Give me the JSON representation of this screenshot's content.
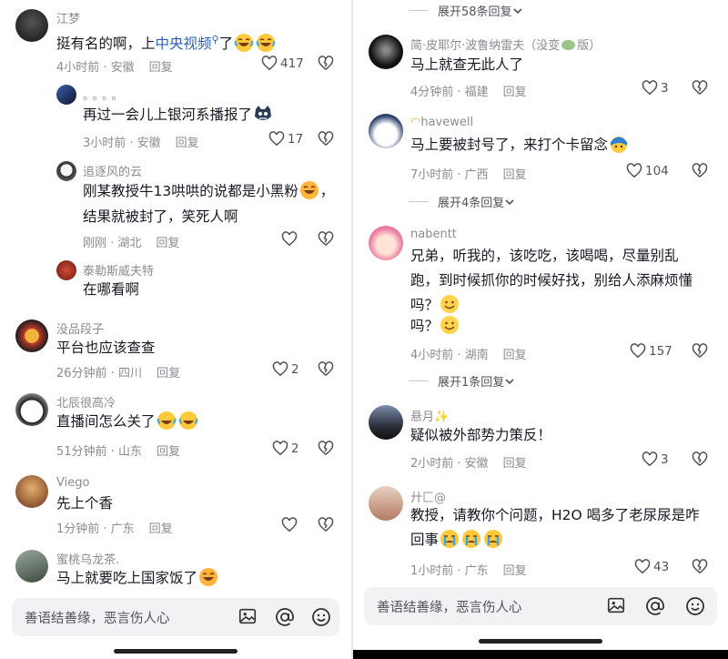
{
  "left": {
    "comments": [
      {
        "name": "江梦",
        "text_before": "挺有名的啊，上",
        "link": "中央视频",
        "text_after": "了",
        "time": "4小时前 · 安徽",
        "reply": "回复",
        "likes": "417"
      },
      {
        "name": "。。。。",
        "text": "再过一会儿上银河系播报了",
        "time": "3小时前 · 安徽",
        "reply": "回复",
        "likes": "17"
      },
      {
        "name": "追逐风的云",
        "text": "刚某教授牛13哄哄的说都是小黑粉",
        "text2": "结果就被封了，笑死人啊",
        "time": "刚刚 · 湖北",
        "reply": "回复",
        "likes": ""
      },
      {
        "name": "泰勒斯威夫特",
        "text": "在哪看啊"
      },
      {
        "name": "没品段子",
        "text": "平台也应该查查",
        "time": "26分钟前 · 四川",
        "reply": "回复",
        "likes": "2"
      },
      {
        "name": "北辰很高冷",
        "text": "直播间怎么关了",
        "time": "51分钟前 · 山东",
        "reply": "回复",
        "likes": "2"
      },
      {
        "name": "Viego",
        "text": "先上个香",
        "time": "1分钟前 · 广东",
        "reply": "回复",
        "likes": ""
      },
      {
        "name": "蜜桃乌龙茶.",
        "text": "马上就要吃上国家饭了"
      }
    ],
    "input_placeholder": "善语结善缘，恶言伤人心"
  },
  "right": {
    "expand_top": "展开58条回复",
    "comments": [
      {
        "name": "简·皮耶尔·波鲁纳雷夫（没变",
        "name_tail": "版）",
        "text": "马上就查无此人了",
        "time": "4分钟前 · 福建",
        "reply": "回复",
        "likes": "3"
      },
      {
        "name": "havewell",
        "text": "马上要被封号了，来打个卡留念",
        "time": "7小时前 · 广西",
        "reply": "回复",
        "likes": "104"
      },
      {
        "name": "nabentt",
        "text": "兄弟，听我的，该吃吃，该喝喝，尽量别乱",
        "text2": "跑，到时候抓你的时候好找，别给人添麻烦懂",
        "text3": "吗？",
        "text4": "吗？",
        "time": "4小时前 · 湖南",
        "reply": "回复",
        "likes": "157"
      },
      {
        "name": "悬月",
        "text": "疑似被外部势力策反！",
        "time": "2小时前 · 安徽",
        "reply": "回复",
        "likes": "3"
      },
      {
        "name": "廾匚@",
        "text": "教授，请教你个问题，H2O 喝多了老尿尿是咋",
        "text2": "回事",
        "time": "1小时前 · 广东",
        "reply": "回复",
        "likes": "43"
      }
    ],
    "expand_mid1": "展开4条回复",
    "expand_mid2": "展开1条回复",
    "input_placeholder": "善语结善缘，恶言伤人心"
  },
  "colors": {
    "text": "#161823",
    "muted": "#8a8b91",
    "link": "#2d5fb8",
    "input_bg": "#f2f2f4"
  },
  "icons": [
    "heart-icon",
    "heart-break-icon",
    "image-icon",
    "at-icon",
    "smile-icon",
    "chevron-down-icon",
    "laugh-cry-emoji",
    "smile-emoji",
    "crying-emoji",
    "cat-emoji",
    "search-icon"
  ]
}
